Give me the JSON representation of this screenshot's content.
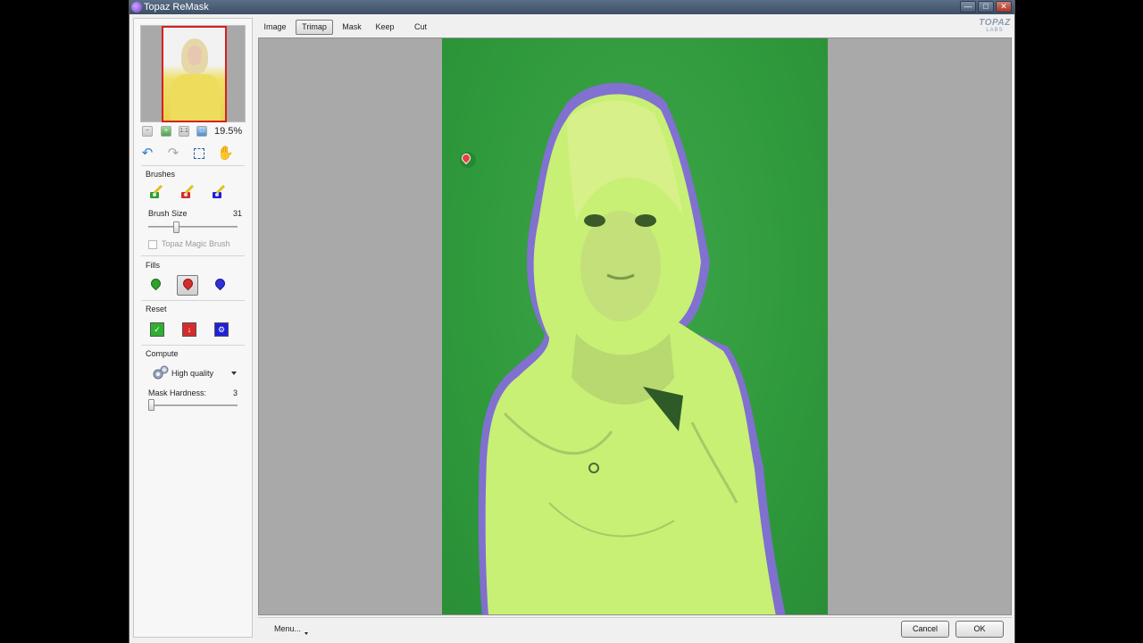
{
  "window": {
    "title": "Topaz ReMask"
  },
  "tabs": [
    {
      "label": "Image",
      "active": false
    },
    {
      "label": "Trimap",
      "active": true
    },
    {
      "label": "Mask",
      "active": false
    },
    {
      "label": "Keep",
      "active": false
    },
    {
      "label": "Cut",
      "active": false
    }
  ],
  "logo": {
    "word": "TOPAZ",
    "sub": "LABS"
  },
  "sidebar": {
    "zoom": {
      "value": "19.5%"
    },
    "brushes": {
      "label": "Brushes",
      "size_label": "Brush Size",
      "size_value": "31",
      "size_fraction": 0.31
    },
    "magic_brush": {
      "label": "Topaz Magic Brush",
      "checked": false,
      "enabled": false
    },
    "fills": {
      "label": "Fills",
      "selected": "cut-fill"
    },
    "reset": {
      "label": "Reset"
    },
    "compute": {
      "label": "Compute",
      "quality_label": "High quality",
      "hardness_label": "Mask Hardness:",
      "hardness_value": "3",
      "hardness_fraction": 0.03
    }
  },
  "bottombar": {
    "menu_label": "Menu...",
    "cancel_label": "Cancel",
    "ok_label": "OK"
  },
  "colors": {
    "keep": "#2fa02f",
    "cut": "#d62b2b",
    "compute": "#2020d8",
    "mask_overlay": "#c8f074",
    "edge": "#8a6be0"
  }
}
